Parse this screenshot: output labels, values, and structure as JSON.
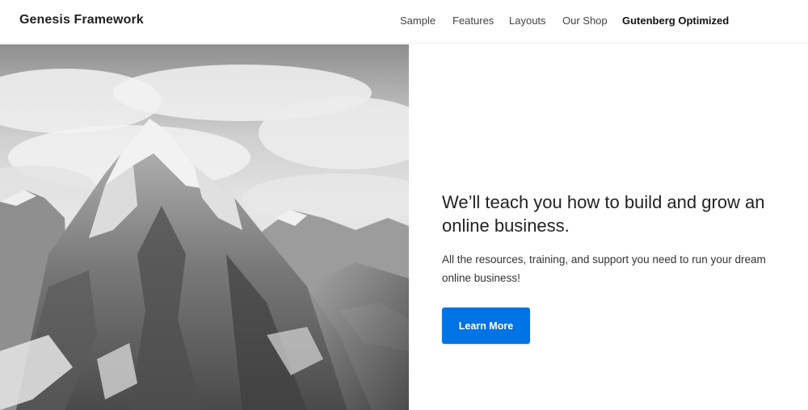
{
  "site": {
    "title": "Genesis Framework"
  },
  "nav": {
    "items": [
      {
        "label": "Sample"
      },
      {
        "label": "Features"
      },
      {
        "label": "Layouts"
      },
      {
        "label": "Our Shop"
      },
      {
        "label": "Gutenberg Optimized"
      }
    ]
  },
  "hero": {
    "image_subject": "mountain-photo",
    "headline": "We’ll teach you how to build and grow an online business.",
    "subtext": "All the resources, training, and support you need to run your dream online business!",
    "cta_label": "Learn More"
  },
  "colors": {
    "accent": "#0073e5",
    "text": "#222222",
    "background": "#ffffff"
  }
}
